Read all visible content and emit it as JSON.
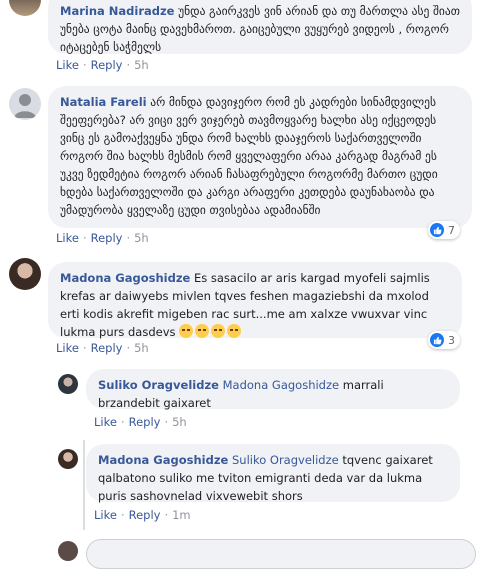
{
  "comments": [
    {
      "author": "Marina Nadiradze",
      "text": "უნდა გაირკვეს ვინ არიან და თუ მართლა ასე შიათ უნება ცოტა მაინც დავეხმაროთ. გაიცებული ვუყურებ ვიდეოს , როგორ იტაცებენ საჭმელს",
      "like": "Like",
      "reply": "Reply",
      "time": "5h"
    },
    {
      "author": "Natalia Fareli",
      "text": "არ მინდა დავიჯერო რომ ეს კადრები სინამდვილეს შეეფერება? არ ვიცი ვერ ვიჯერებ თავმოყვარე ხალხი ასე იქცეოდეს ვინც ეს გამოაქვეყნა უნდა რომ ხალხს დააჯეროს საქართველოში როგორ შია ხალხს მესმის რომ ყველაფერი არაა კარგად მაგრამ ეს უკვე ზედმეტია როგორ არიან ჩასაფრებული როგორმე მართო ცუდი ხდება საქართველოში და კარგი არაფერი კეთდება დაუნახაობა და უმადურობა ყველაზე ცუდი თვისებაა ადამიანში",
      "like": "Like",
      "reply": "Reply",
      "time": "5h",
      "reaction_count": "7"
    },
    {
      "author": "Madona Gagoshidze",
      "text": "Es sasacilo ar aris kargad myofeli sajmlis krefas ar daiwyebs mivlen tqves feshen magaziebshi da mxolod erti kodis akrefit migeben rac surt...me am xalxze vwuxvar vinc lukma purs dasdevs",
      "emoji_count": 4,
      "like": "Like",
      "reply": "Reply",
      "time": "5h",
      "reaction_count": "3"
    }
  ],
  "replies": [
    {
      "author": "Suliko Oragvelidze",
      "mention": "Madona Gagoshidze",
      "text": "marrali brzandebit gaixaret",
      "like": "Like",
      "reply": "Reply",
      "time": "5h"
    },
    {
      "author": "Madona Gagoshidze",
      "mention": "Suliko Oragvelidze",
      "text": "tqvenc gaixaret qalbatono suliko me tviton emigranti deda var da lukma puris sashovnelad vixvewebit shors",
      "like": "Like",
      "reply": "Reply",
      "time": "1m"
    }
  ],
  "colors": {
    "name": "#385898",
    "bubble": "#f0f2f5",
    "like_badge": "#1877f2",
    "meta": "#90949c"
  },
  "icons": {
    "reaction": "thumbs-up-icon",
    "emoji": "disappointed-face-emoji"
  }
}
